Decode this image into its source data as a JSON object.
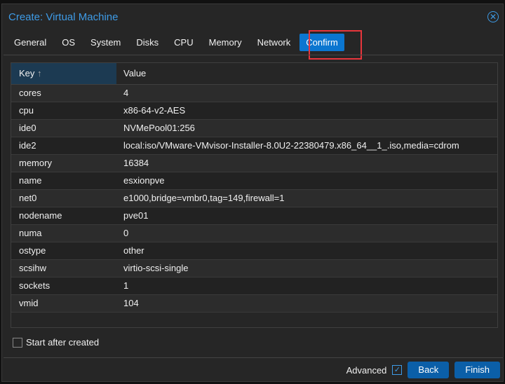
{
  "window": {
    "title": "Create: Virtual Machine",
    "close_icon": "close-circle-icon"
  },
  "tabs": [
    {
      "label": "General"
    },
    {
      "label": "OS"
    },
    {
      "label": "System"
    },
    {
      "label": "Disks"
    },
    {
      "label": "CPU"
    },
    {
      "label": "Memory"
    },
    {
      "label": "Network"
    },
    {
      "label": "Confirm"
    }
  ],
  "grid": {
    "key_header": "Key",
    "sort_indicator": "↑",
    "value_header": "Value",
    "rows": [
      {
        "key": "cores",
        "value": "4"
      },
      {
        "key": "cpu",
        "value": "x86-64-v2-AES"
      },
      {
        "key": "ide0",
        "value": "NVMePool01:256"
      },
      {
        "key": "ide2",
        "value": "local:iso/VMware-VMvisor-Installer-8.0U2-22380479.x86_64__1_.iso,media=cdrom"
      },
      {
        "key": "memory",
        "value": "16384"
      },
      {
        "key": "name",
        "value": "esxionpve"
      },
      {
        "key": "net0",
        "value": "e1000,bridge=vmbr0,tag=149,firewall=1"
      },
      {
        "key": "nodename",
        "value": "pve01"
      },
      {
        "key": "numa",
        "value": "0"
      },
      {
        "key": "ostype",
        "value": "other"
      },
      {
        "key": "scsihw",
        "value": "virtio-scsi-single"
      },
      {
        "key": "sockets",
        "value": "1"
      },
      {
        "key": "vmid",
        "value": "104"
      }
    ]
  },
  "start_after_created": {
    "label": "Start after created",
    "checked": false
  },
  "footer": {
    "advanced_label": "Advanced",
    "advanced_checked": true,
    "back": "Back",
    "finish": "Finish"
  }
}
